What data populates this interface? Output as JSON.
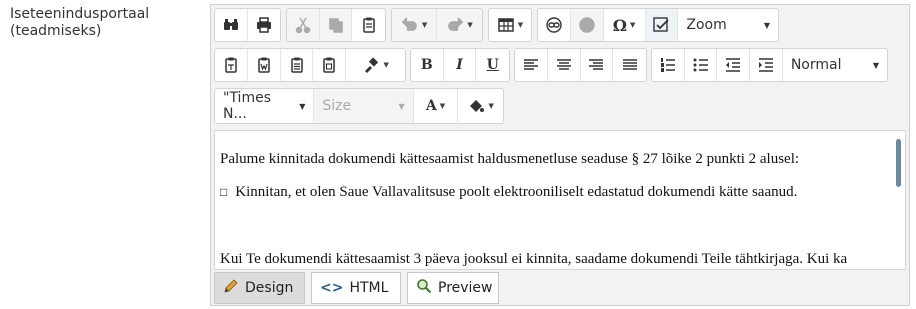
{
  "field_label": "Iseteenindusportaal (teadmiseks)",
  "toolbar": {
    "zoom_label": "Zoom",
    "paragraph_format": "Normal",
    "font_name": "\"Times N...",
    "font_size": "Size",
    "font_color_letter": "A",
    "bold": "B",
    "italic": "I",
    "underline": "U",
    "special_char": "Ω"
  },
  "content": {
    "line1": "Palume kinnitada dokumendi kättesaamist haldusmenetluse seaduse § 27 lõike 2 punkti 2 alusel:",
    "checkbox_glyph": "□",
    "line2": "Kinnitan, et olen Saue Vallavalitsuse poolt elektrooniliselt edastatud dokumendi kätte saanud.",
    "line3": "Kui Te dokumendi kättesaamist 3 päeva jooksul ei kinnita, saadame dokumendi Teile tähtkirjaga. Kui ka"
  },
  "modes": {
    "design": "Design",
    "html": "HTML",
    "preview": "Preview"
  }
}
